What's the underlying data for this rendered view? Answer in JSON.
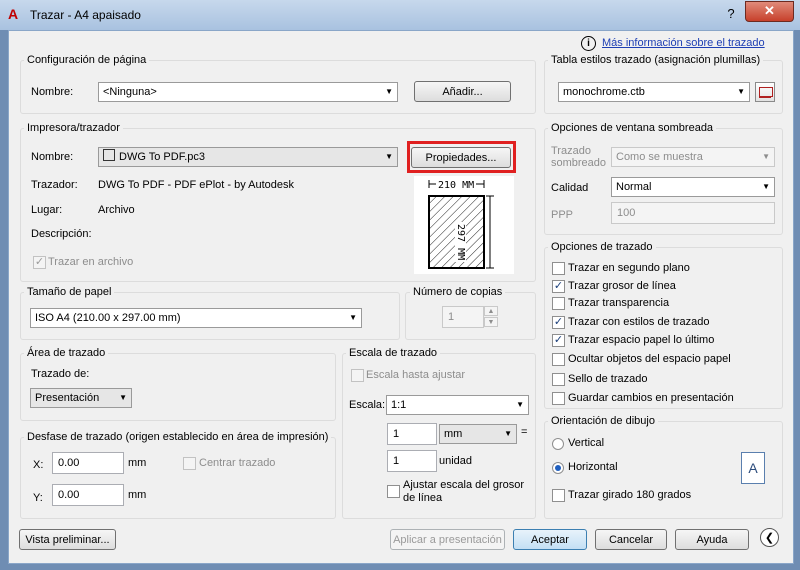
{
  "window": {
    "title": "Trazar - A4 apaisado",
    "help_glyph": "?",
    "close_glyph": "✕"
  },
  "info_link": "Más información sobre el trazado",
  "page_setup": {
    "title": "Configuración de página",
    "name_label": "Nombre:",
    "name_value": "<Ninguna>",
    "add_button": "Añadir..."
  },
  "printer": {
    "title": "Impresora/trazador",
    "name_label": "Nombre:",
    "name_value": "DWG To PDF.pc3",
    "properties_button": "Propiedades...",
    "plotter_label": "Trazador:",
    "plotter_value": "DWG To PDF - PDF ePlot - by Autodesk",
    "where_label": "Lugar:",
    "where_value": "Archivo",
    "description_label": "Descripción:",
    "plot_to_file_label": "Trazar en archivo",
    "preview_width": "210 MM",
    "preview_height": "297 MM"
  },
  "paper_size": {
    "title": "Tamaño de papel",
    "value": "ISO A4 (210.00 x 297.00 mm)"
  },
  "copies": {
    "title": "Número de copias",
    "value": "1"
  },
  "plot_area": {
    "title": "Área de trazado",
    "what_label": "Trazado de:",
    "what_value": "Presentación"
  },
  "plot_offset": {
    "title": "Desfase de trazado (origen establecido en área de impresión)",
    "x_label": "X:",
    "x_value": "0.00",
    "y_label": "Y:",
    "y_value": "0.00",
    "unit": "mm",
    "center_label": "Centrar trazado"
  },
  "plot_scale": {
    "title": "Escala de trazado",
    "fit_label": "Escala hasta ajustar",
    "scale_label": "Escala:",
    "scale_value": "1:1",
    "value1": "1",
    "unit1": "mm",
    "equals": "=",
    "value2": "1",
    "unit2": "unidad",
    "lineweights_label_1": "Ajustar escala del grosor",
    "lineweights_label_2": "de línea"
  },
  "style_table": {
    "title": "Tabla estilos trazado (asignación plumillas)",
    "value": "monochrome.ctb"
  },
  "shaded": {
    "title": "Opciones de ventana sombreada",
    "shade_label_1": "Trazado",
    "shade_label_2": "sombreado",
    "shade_value": "Como se muestra",
    "quality_label": "Calidad",
    "quality_value": "Normal",
    "dpi_label": "PPP",
    "dpi_value": "100"
  },
  "plot_options": {
    "title": "Opciones de trazado",
    "items": [
      {
        "label": "Trazar en segundo plano",
        "checked": false
      },
      {
        "label": "Trazar grosor de línea",
        "checked": true
      },
      {
        "label": "Trazar transparencia",
        "checked": false
      },
      {
        "label": "Trazar con estilos de trazado",
        "checked": true
      },
      {
        "label": "Trazar espacio papel lo último",
        "checked": true
      },
      {
        "label": "Ocultar objetos del espacio papel",
        "checked": false
      },
      {
        "label": "Sello de trazado",
        "checked": false
      },
      {
        "label": "Guardar cambios en presentación",
        "checked": false
      }
    ]
  },
  "orientation": {
    "title": "Orientación de dibujo",
    "vertical_label": "Vertical",
    "horizontal_label": "Horizontal",
    "upside_down_label": "Trazar girado 180 grados",
    "selected": "Horizontal",
    "icon_letter": "A"
  },
  "footer": {
    "preview": "Vista preliminar...",
    "apply": "Aplicar a presentación",
    "ok": "Aceptar",
    "cancel": "Cancelar",
    "help": "Ayuda",
    "collapse_glyph": "❮"
  }
}
